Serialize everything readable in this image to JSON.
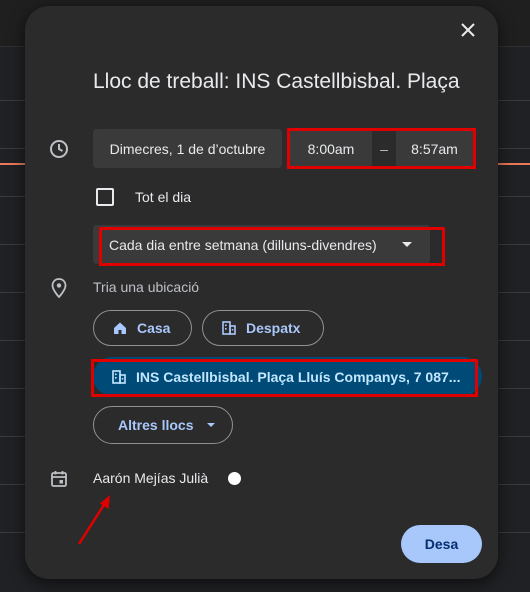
{
  "dialog": {
    "title": "Lloc de treball: INS Castellbisbal. Plaça",
    "date": "Dimecres, 1 de d’octubre",
    "start_time": "8:00am",
    "time_separator": "–",
    "end_time": "8:57am",
    "all_day_label": "Tot el dia",
    "all_day_checked": false,
    "repeat": "Cada dia entre setmana (dilluns-divendres)",
    "location_prompt": "Tria una ubicació",
    "location_options": [
      {
        "label": "Casa",
        "icon": "home-icon"
      },
      {
        "label": "Despatx",
        "icon": "building-icon"
      }
    ],
    "selected_location": {
      "label": "INS Castellbisbal. Plaça Lluís Companys, 7 087...",
      "icon": "building-icon"
    },
    "other_places_label": "Altres llocs",
    "owner": "Aarón Mejías Julià",
    "owner_color": "#ffffff",
    "save_label": "Desa"
  },
  "colors": {
    "dialog_bg": "#2b2b2b",
    "accent": "#a8c7fa",
    "selected_bg": "#004a77",
    "annotation": "#e00000",
    "now_line": "#e8795a"
  }
}
